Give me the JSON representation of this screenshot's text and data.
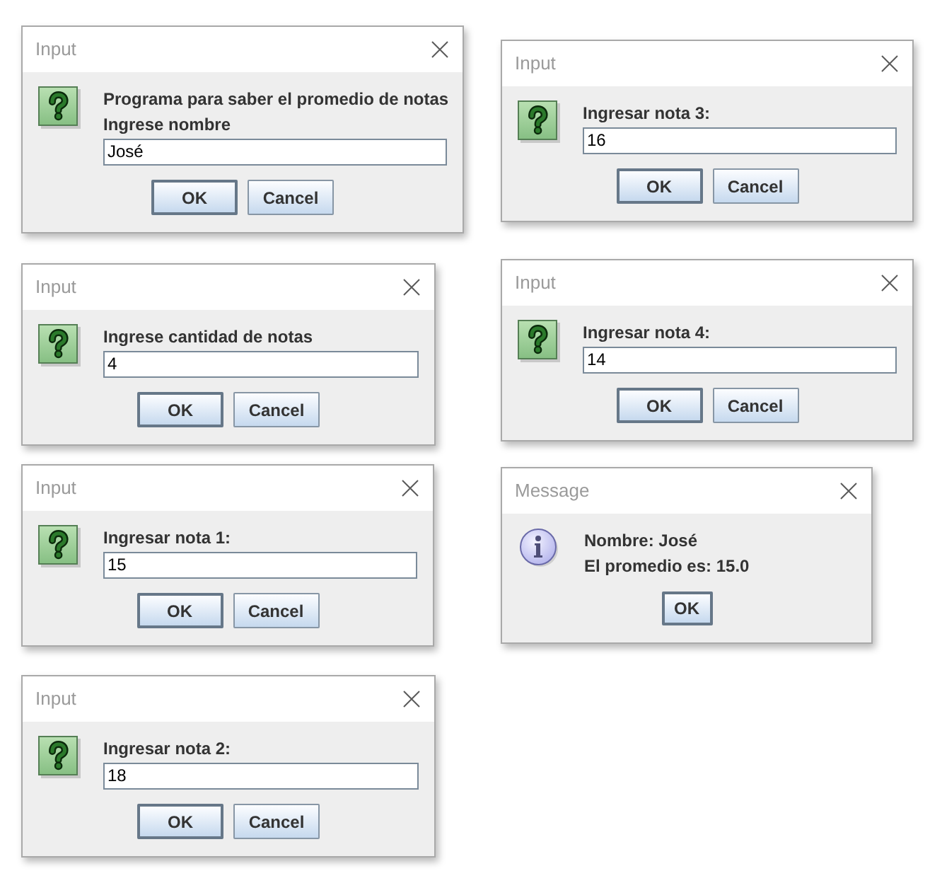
{
  "dialogs": [
    {
      "kind": "input",
      "title": "Input",
      "lines": [
        "Programa para saber el promedio de notas",
        "Ingrese nombre"
      ],
      "value": "José",
      "buttons": [
        {
          "label": "OK",
          "default": true
        },
        {
          "label": "Cancel",
          "default": false
        }
      ]
    },
    {
      "kind": "input",
      "title": "Input",
      "lines": [
        "Ingrese cantidad de notas"
      ],
      "value": "4",
      "buttons": [
        {
          "label": "OK",
          "default": true
        },
        {
          "label": "Cancel",
          "default": false
        }
      ]
    },
    {
      "kind": "input",
      "title": "Input",
      "lines": [
        "Ingresar nota 1:"
      ],
      "value": "15",
      "buttons": [
        {
          "label": "OK",
          "default": true
        },
        {
          "label": "Cancel",
          "default": false
        }
      ]
    },
    {
      "kind": "input",
      "title": "Input",
      "lines": [
        "Ingresar nota 2:"
      ],
      "value": "18",
      "buttons": [
        {
          "label": "OK",
          "default": true
        },
        {
          "label": "Cancel",
          "default": false
        }
      ]
    },
    {
      "kind": "input",
      "title": "Input",
      "lines": [
        "Ingresar nota 3:"
      ],
      "value": "16",
      "buttons": [
        {
          "label": "OK",
          "default": true
        },
        {
          "label": "Cancel",
          "default": false
        }
      ]
    },
    {
      "kind": "input",
      "title": "Input",
      "lines": [
        "Ingresar nota 4:"
      ],
      "value": "14",
      "buttons": [
        {
          "label": "OK",
          "default": true
        },
        {
          "label": "Cancel",
          "default": false
        }
      ]
    },
    {
      "kind": "message",
      "title": "Message",
      "lines": [
        "Nombre: José",
        "El promedio es: 15.0"
      ],
      "buttons": [
        {
          "label": "OK",
          "default": true
        }
      ]
    }
  ]
}
